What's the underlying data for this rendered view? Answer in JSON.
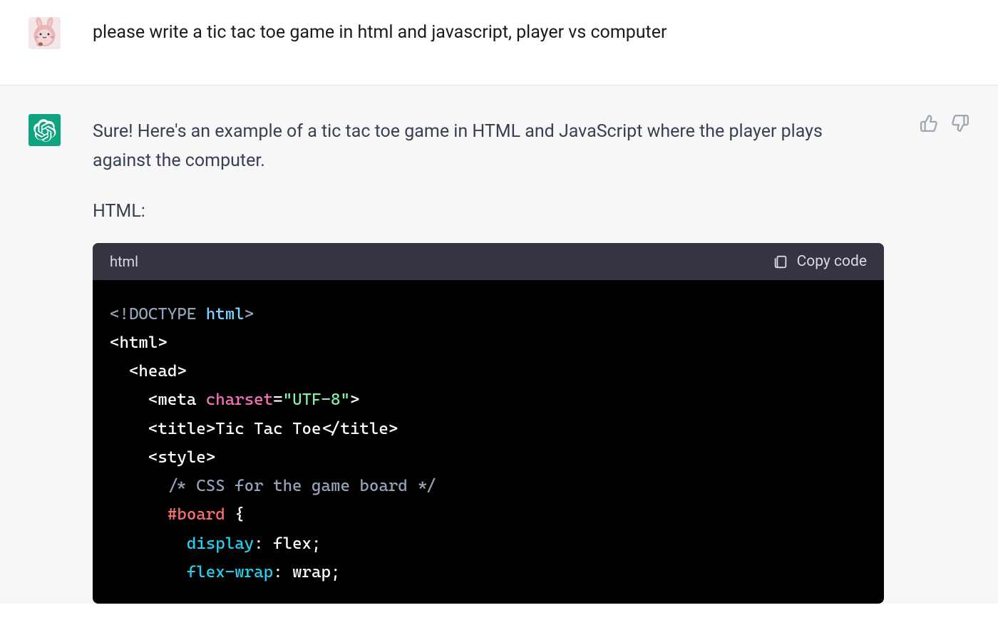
{
  "user": {
    "message": "please write a tic tac toe game in html and javascript, player vs computer"
  },
  "assistant": {
    "intro": "Sure! Here's an example of a tic tac toe game in HTML and JavaScript where the player plays against the computer.",
    "code_label": "HTML:"
  },
  "code_block": {
    "language": "html",
    "copy_label": "Copy code",
    "tokens": {
      "doctype_prefix": "<!DOCTYPE ",
      "doctype_html": "html",
      "doctype_close": ">",
      "html_open": "<html>",
      "head_open": "<head>",
      "meta_open": "<meta",
      "charset_attr": "charset",
      "equals": "=",
      "utf8_val": "\"UTF-8\"",
      "meta_close": ">",
      "title_open": "<title>",
      "title_text": "Tic Tac Toe",
      "title_close": "</title>",
      "style_open": "<style>",
      "comment": "/* CSS for the game board */",
      "selector_board": "#board",
      "brace_open": "{",
      "prop_display": "display",
      "colon": ":",
      "val_flex": " flex",
      "semi": ";",
      "prop_flexwrap": "flex-wrap",
      "val_wrap": " wrap"
    }
  },
  "icons": {
    "thumbs_up": "thumbs-up-icon",
    "thumbs_down": "thumbs-down-icon",
    "clipboard": "clipboard-icon"
  }
}
